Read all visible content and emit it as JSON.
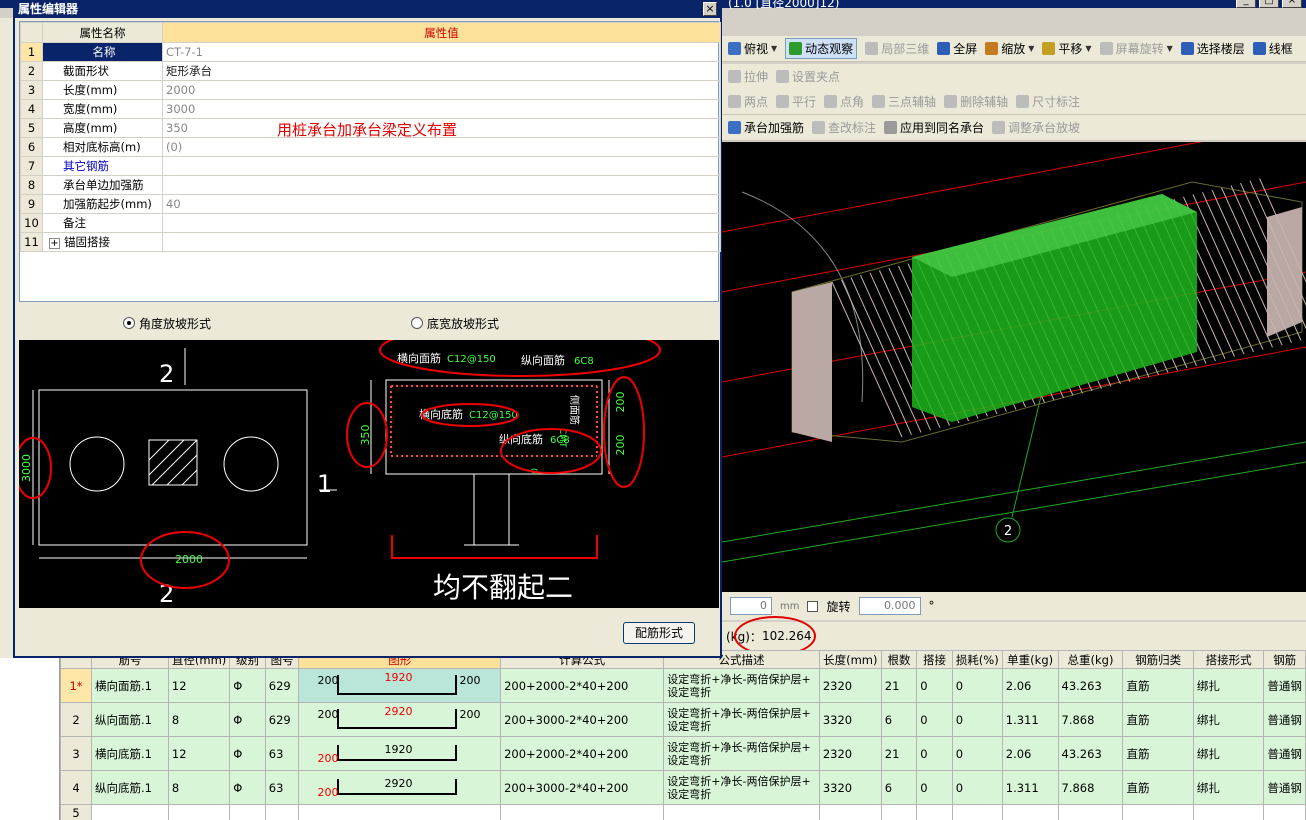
{
  "window": {
    "caption": "(1.0 [直径2000]12)",
    "buttons": [
      "_",
      "□",
      "×"
    ]
  },
  "toolbar1": [
    {
      "label": "俯视",
      "icon": "view-icon",
      "caret": true,
      "state": "normal"
    },
    {
      "label": "动态观察",
      "icon": "orbit-icon",
      "caret": false,
      "state": "active"
    },
    {
      "label": "局部三维",
      "icon": "local-3d-icon",
      "caret": false,
      "state": "disabled"
    },
    {
      "label": "全屏",
      "icon": "fullscreen-icon",
      "caret": false,
      "state": "normal"
    },
    {
      "label": "缩放",
      "icon": "zoom-icon",
      "caret": true,
      "state": "normal"
    },
    {
      "label": "平移",
      "icon": "pan-icon",
      "caret": true,
      "state": "normal"
    },
    {
      "label": "屏幕旋转",
      "icon": "rotate-icon",
      "caret": true,
      "state": "disabled"
    },
    {
      "label": "选择楼层",
      "icon": "floor-icon",
      "caret": false,
      "state": "normal"
    },
    {
      "label": "线框",
      "icon": "wireframe-icon",
      "caret": false,
      "state": "normal"
    }
  ],
  "toolbar2": [
    {
      "label": "拉伸",
      "icon": "stretch-icon",
      "state": "disabled"
    },
    {
      "label": "设置夹点",
      "icon": "grip-icon",
      "state": "disabled"
    }
  ],
  "toolbar3": [
    {
      "label": "两点",
      "icon": "two-point-icon",
      "state": "disabled"
    },
    {
      "label": "平行",
      "icon": "parallel-icon",
      "state": "disabled"
    },
    {
      "label": "点角",
      "icon": "point-angle-icon",
      "state": "disabled"
    },
    {
      "label": "三点辅轴",
      "icon": "three-point-axis-icon",
      "state": "disabled"
    },
    {
      "label": "删除辅轴",
      "icon": "delete-axis-icon",
      "state": "disabled"
    },
    {
      "label": "尺寸标注",
      "icon": "dimension-icon",
      "state": "disabled"
    }
  ],
  "toolbar4": [
    {
      "label": "承台加强筋",
      "icon": "reinforce-icon",
      "state": "normal"
    },
    {
      "label": "查改标注",
      "icon": "edit-label-icon",
      "state": "disabled"
    },
    {
      "label": "应用到同名承台",
      "icon": "apply-same-icon",
      "state": "normal"
    },
    {
      "label": "调整承台放坡",
      "icon": "slope-icon",
      "state": "disabled"
    }
  ],
  "view3d": {
    "axis_label": "2"
  },
  "rotate_bar": {
    "value_a": "0",
    "unit": "mm",
    "rotate_label": "旋转",
    "rotate_value": "0.000",
    "degree": "°"
  },
  "total_weight": {
    "label": "(kg)：",
    "value": "102.264"
  },
  "dialog": {
    "title": "属性编辑器",
    "close": "×",
    "col_name": "属性名称",
    "col_value": "属性值",
    "rows": [
      {
        "no": "1",
        "name": "名称",
        "value": "CT-7-1",
        "blue": false
      },
      {
        "no": "2",
        "name": "截面形状",
        "value": "矩形承台",
        "blue": false
      },
      {
        "no": "3",
        "name": "长度(mm)",
        "value": "2000",
        "blue": false
      },
      {
        "no": "4",
        "name": "宽度(mm)",
        "value": "3000",
        "blue": false
      },
      {
        "no": "5",
        "name": "高度(mm)",
        "value": "350",
        "blue": false
      },
      {
        "no": "6",
        "name": "相对底标高(m)",
        "value": "(0)",
        "blue": false
      },
      {
        "no": "7",
        "name": "其它钢筋",
        "value": "",
        "blue": true
      },
      {
        "no": "8",
        "name": "承台单边加强筋",
        "value": "",
        "blue": false
      },
      {
        "no": "9",
        "name": "加强筋起步(mm)",
        "value": "40",
        "blue": false
      },
      {
        "no": "10",
        "name": "备注",
        "value": "",
        "blue": false
      },
      {
        "no": "11",
        "name": "锚固搭接",
        "value": "",
        "blue": false,
        "expander": "+"
      }
    ],
    "note": "用桩承台加承台梁定义布置",
    "radio1": "角度放坡形式",
    "radio2": "底宽放坡形式",
    "button": "配筋形式"
  },
  "drawing": {
    "plan_top": "2",
    "plan_bottom": "2",
    "plan_right": "1",
    "dim_width": "3000",
    "dim_length": "2000",
    "top_bar_label": "横向面筋",
    "top_bar_spec": "C12@150",
    "long_top_label": "纵向面筋",
    "long_top_spec": "6C8",
    "bottom_bar_label": "横向底筋",
    "bottom_bar_spec": "C12@150",
    "long_bottom_label": "纵向底筋",
    "long_bottom_spec": "6C8",
    "side_label": "侧面筋",
    "side_spec": "CMT",
    "height_dim": "350",
    "right_dim_1": "200",
    "right_dim_2": "200",
    "small_dim": "0",
    "big_text": "均不翻起二"
  },
  "grid": {
    "headers": [
      "",
      "筋号",
      "直径(mm)",
      "级别",
      "图号",
      "图形",
      "计算公式",
      "公式描述",
      "长度(mm)",
      "根数",
      "搭接",
      "损耗(%)",
      "单重(kg)",
      "总重(kg)",
      "钢筋归类",
      "搭接形式",
      "钢筋"
    ],
    "rows": [
      {
        "no": "1*",
        "name": "横向面筋.1",
        "dia": "12",
        "grade": "Φ",
        "fig": "629",
        "left": "200",
        "mid": "1920",
        "right": "200",
        "shape_type": "u",
        "formula": "200+2000-2*40+200",
        "desc1": "设定弯折+净长-两倍保护层+",
        "desc2": "设定弯折",
        "len": "2320",
        "count": "21",
        "lap": "0",
        "loss": "0",
        "unit_w": "2.06",
        "total_w": "43.263",
        "cls": "直筋",
        "lap_type": "绑扎",
        "type": "普通钢"
      },
      {
        "no": "2",
        "name": "纵向面筋.1",
        "dia": "8",
        "grade": "Φ",
        "fig": "629",
        "left": "200",
        "mid": "2920",
        "right": "200",
        "shape_type": "u",
        "formula": "200+3000-2*40+200",
        "desc1": "设定弯折+净长-两倍保护层+",
        "desc2": "设定弯折",
        "len": "3320",
        "count": "6",
        "lap": "0",
        "loss": "0",
        "unit_w": "1.311",
        "total_w": "7.868",
        "cls": "直筋",
        "lap_type": "绑扎",
        "type": "普通钢"
      },
      {
        "no": "3",
        "name": "横向底筋.1",
        "dia": "12",
        "grade": "Φ",
        "fig": "63",
        "left": "200",
        "mid": "1920",
        "right": "",
        "shape_type": "bottom",
        "formula": "200+2000-2*40+200",
        "desc1": "设定弯折+净长-两倍保护层+",
        "desc2": "设定弯折",
        "len": "2320",
        "count": "21",
        "lap": "0",
        "loss": "0",
        "unit_w": "2.06",
        "total_w": "43.263",
        "cls": "直筋",
        "lap_type": "绑扎",
        "type": "普通钢"
      },
      {
        "no": "4",
        "name": "纵向底筋.1",
        "dia": "8",
        "grade": "Φ",
        "fig": "63",
        "left": "200",
        "mid": "2920",
        "right": "",
        "shape_type": "bottom",
        "formula": "200+3000-2*40+200",
        "desc1": "设定弯折+净长-两倍保护层+",
        "desc2": "设定弯折",
        "len": "3320",
        "count": "6",
        "lap": "0",
        "loss": "0",
        "unit_w": "1.311",
        "total_w": "7.868",
        "cls": "直筋",
        "lap_type": "绑扎",
        "type": "普通钢"
      },
      {
        "no": "5",
        "name": "",
        "dia": "",
        "grade": "",
        "fig": "",
        "left": "",
        "mid": "",
        "right": "",
        "shape_type": "none",
        "formula": "",
        "desc1": "",
        "desc2": "",
        "len": "",
        "count": "",
        "lap": "",
        "loss": "",
        "unit_w": "",
        "total_w": "",
        "cls": "",
        "lap_type": "",
        "type": ""
      }
    ]
  }
}
